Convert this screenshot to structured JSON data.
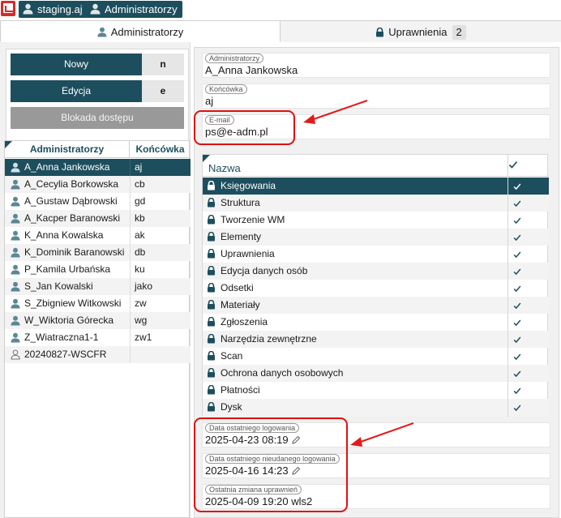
{
  "topbar": {
    "chips": [
      {
        "label": "staging.aj"
      },
      {
        "label": "Administratorzy"
      }
    ]
  },
  "tabs": {
    "admins_label": "Administratorzy",
    "permissions_label": "Uprawnienia",
    "permissions_count": "2"
  },
  "actions": {
    "new_label": "Nowy",
    "new_key": "n",
    "edit_label": "Edycja",
    "edit_key": "e",
    "block_label": "Blokada dostępu"
  },
  "admin_list": {
    "col_name": "Administratorzy",
    "col_suffix": "Końcówka",
    "rows": [
      {
        "name": "A_Anna Jankowska",
        "suffix": "aj"
      },
      {
        "name": "A_Cecylia Borkowska",
        "suffix": "cb"
      },
      {
        "name": "A_Gustaw Dąbrowski",
        "suffix": "gd"
      },
      {
        "name": "A_Kacper Baranowski",
        "suffix": "kb"
      },
      {
        "name": "K_Anna Kowalska",
        "suffix": "ak"
      },
      {
        "name": "K_Dominik Baranowski",
        "suffix": "db"
      },
      {
        "name": "P_Kamila Urbańska",
        "suffix": "ku"
      },
      {
        "name": "S_Jan Kowalski",
        "suffix": "jako"
      },
      {
        "name": "S_Zbigniew Witkowski",
        "suffix": "zw"
      },
      {
        "name": "W_Wiktoria Górecka",
        "suffix": "wg"
      },
      {
        "name": "Z_Wiatraczna1-1",
        "suffix": "zw1"
      },
      {
        "name": "20240827-WSCFR",
        "suffix": ""
      }
    ]
  },
  "details": {
    "admin_label": "Administratorzy",
    "admin_value": "A_Anna Jankowska",
    "suffix_label": "Końcówka",
    "suffix_value": "aj",
    "email_label": "E-mail",
    "email_value": "ps@e-adm.pl",
    "last_login_label": "Data ostatniego logowania",
    "last_login_value": "2025-04-23 08:19",
    "last_failed_label": "Data ostatniego nieudanego logowania",
    "last_failed_value": "2025-04-16 14:23",
    "last_perm_change_label": "Ostatnia zmiana uprawnień",
    "last_perm_change_value": "2025-04-09 19:20 wls2"
  },
  "permissions_grid": {
    "col_name": "Nazwa",
    "rows": [
      {
        "label": "Księgowania",
        "checked": true
      },
      {
        "label": "Struktura",
        "checked": true
      },
      {
        "label": "Tworzenie WM",
        "checked": true
      },
      {
        "label": "Elementy",
        "checked": true
      },
      {
        "label": "Uprawnienia",
        "checked": true
      },
      {
        "label": "Edycja danych osób",
        "checked": true
      },
      {
        "label": "Odsetki",
        "checked": true
      },
      {
        "label": "Materiały",
        "checked": true
      },
      {
        "label": "Zgłoszenia",
        "checked": true
      },
      {
        "label": "Narzędzia zewnętrzne",
        "checked": true
      },
      {
        "label": "Scan",
        "checked": true
      },
      {
        "label": "Ochrona danych osobowych",
        "checked": true
      },
      {
        "label": "Płatności",
        "checked": true
      },
      {
        "label": "Dysk",
        "checked": true
      }
    ]
  },
  "colors": {
    "accent": "#1d4e5e",
    "highlight": "#dd1111"
  }
}
